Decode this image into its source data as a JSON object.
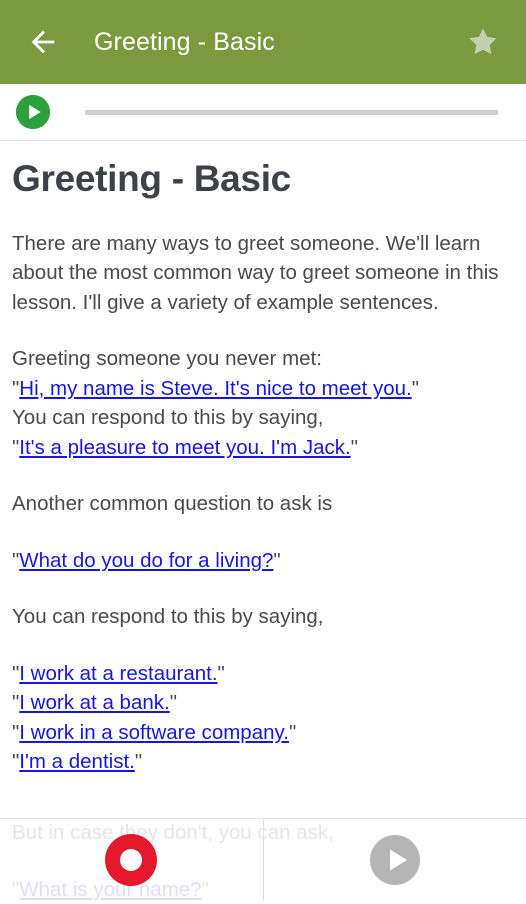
{
  "appbar": {
    "back_icon": "back-arrow-icon",
    "title": "Greeting - Basic",
    "favorite_icon": "star-icon",
    "background_color": "#7a9a3d",
    "title_color": "#ffffff",
    "star_color": "#c3cfb0"
  },
  "player": {
    "play_icon": "play-circle-icon",
    "play_color": "#2ba03b",
    "seek_track_color": "#cfcfcf",
    "seek_progress_percent": 0
  },
  "lesson": {
    "title": "Greeting - Basic",
    "intro": "There are many ways to greet someone. We'll learn about the most common way to greet someone in this lesson. I'll give a variety of example sentences.",
    "block2_line1": "Greeting someone you never met:",
    "block2_line2_phrase": "Hi, my name is Steve. It's nice to meet you.",
    "block2_line3": "You can respond to this by saying,",
    "block2_line4_phrase": "It's a pleasure to meet you. I'm Jack.",
    "block3_line1": "Another common question to ask is",
    "block4_phrase": "What do you do for a living?",
    "block5_line1": "You can respond to this by saying,",
    "block6_phrases": [
      "I work at a restaurant.",
      "I work at a bank.",
      "I work in a software company.",
      "I'm a dentist."
    ],
    "block7_line1": "But in case they don't, you can ask,",
    "block7_phrase": "What is your name?",
    "quote_mark": "\"",
    "link_color": "#1616e8",
    "text_color": "#4a4a4a",
    "title_color": "#3d4148"
  },
  "recorder": {
    "record_icon": "record-circle-icon",
    "record_color": "#e5192c",
    "playback_icon": "play-circle-icon",
    "playback_color": "#b5b5b5"
  }
}
